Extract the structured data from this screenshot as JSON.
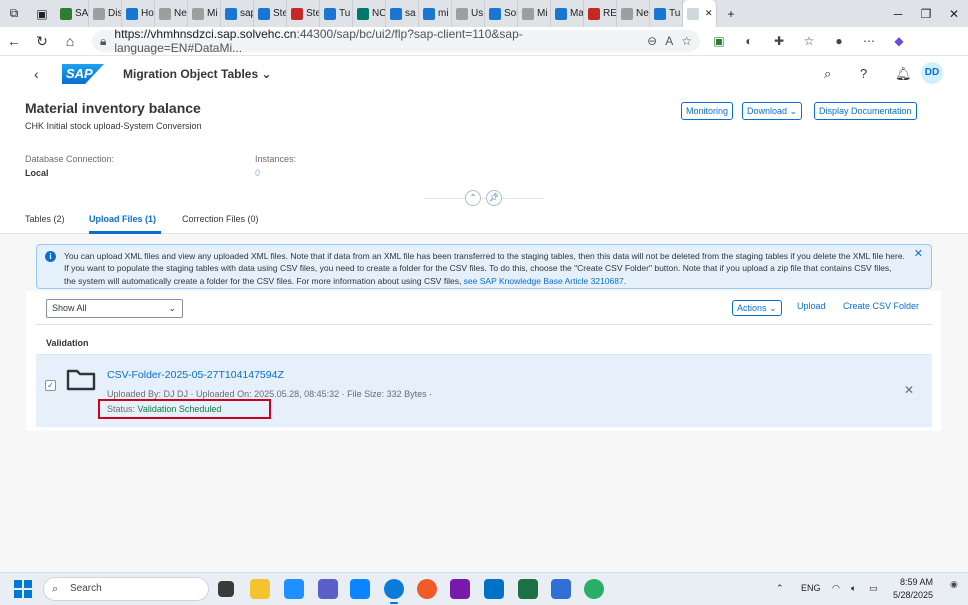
{
  "browser": {
    "tabs": [
      {
        "label": "SA",
        "color": "#2e7d32"
      },
      {
        "label": "Dis",
        "color": "#9e9e9e"
      },
      {
        "label": "Ho",
        "color": "#1976d2"
      },
      {
        "label": "Ne",
        "color": "#9e9e9e"
      },
      {
        "label": "Mi",
        "color": "#9e9e9e"
      },
      {
        "label": "sap",
        "color": "#1976d2"
      },
      {
        "label": "Ste",
        "color": "#1976d2"
      },
      {
        "label": "Ste",
        "color": "#c62828"
      },
      {
        "label": "Tu",
        "color": "#1976d2"
      },
      {
        "label": "NC",
        "color": "#00796b"
      },
      {
        "label": "sa",
        "color": "#1976d2"
      },
      {
        "label": "mi",
        "color": "#1976d2"
      },
      {
        "label": "Us",
        "color": "#9e9e9e"
      },
      {
        "label": "Sol",
        "color": "#1976d2"
      },
      {
        "label": "Mi",
        "color": "#9e9e9e"
      },
      {
        "label": "Ma",
        "color": "#1976d2"
      },
      {
        "label": "RE",
        "color": "#c62828"
      },
      {
        "label": "Ne",
        "color": "#9e9e9e"
      },
      {
        "label": "Tu",
        "color": "#1976d2"
      },
      {
        "label": "",
        "color": "#cfd8dc",
        "active": true
      }
    ],
    "url_host": "https://vhmhnsdzci.sap.solvehc.cn",
    "url_rest": ":44300/sap/bc/ui2/flp?sap-client=110&sap-language=EN#DataMi..."
  },
  "shell": {
    "logo": "SAP",
    "title": "Migration Object Tables",
    "avatar": "DD"
  },
  "header": {
    "title": "Material inventory balance",
    "subtitle": "CHK Initial stock upload-System Conversion",
    "buttons": {
      "monitoring": "Monitoring",
      "download": "Download",
      "display_doc": "Display Documentation"
    },
    "db_label": "Database Connection:",
    "db_value": "Local",
    "instances_label": "Instances:",
    "instances_value": "0"
  },
  "tabs": {
    "tables": "Tables (2)",
    "upload_files": "Upload Files (1)",
    "correction_files": "Correction Files (0)"
  },
  "info": {
    "text": "You can upload XML files and view any uploaded XML files. Note that if data from an XML file has been transferred to the staging tables, then this data will not be deleted from the staging tables if you delete the XML file here. If you want to populate the staging tables with data using CSV files, you need to create a folder for the CSV files. To do this, choose the \"Create CSV Folder\" button. Note that if you upload a zip file that contains CSV files, the system will automatically create a folder for the CSV files. For more information about using CSV files, ",
    "link": "see SAP Knowledge Base Article 3210687",
    "end": "."
  },
  "toolbar": {
    "filter": "Show All",
    "actions": "Actions",
    "upload": "Upload",
    "create_csv": "Create CSV Folder"
  },
  "list": {
    "header": "Validation",
    "item": {
      "name": "CSV-Folder-2025-05-27T104147594Z",
      "meta": "Uploaded By: DJ DJ · Uploaded On: 2025.05.28, 08:45:32 · File Size: 332 Bytes ·",
      "status_label": "Status:",
      "status_value": "Validation Scheduled"
    }
  },
  "taskbar": {
    "search": "Search",
    "lang": "ENG",
    "time": "8:59 AM",
    "date": "5/28/2025"
  }
}
